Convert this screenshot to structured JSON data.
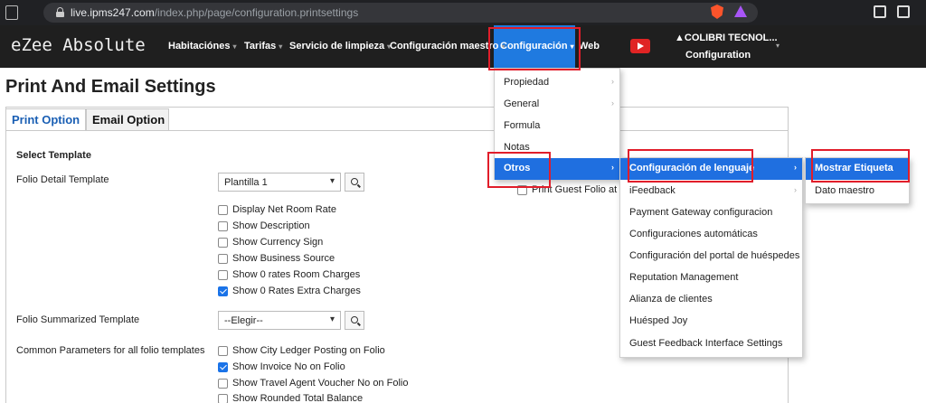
{
  "browser": {
    "url_host": "live.ipms247.com",
    "url_path": "/index.php/page/configuration.printsettings"
  },
  "app": {
    "logo": "eZee Absolute",
    "nav": [
      {
        "label": "Habitaciónes",
        "caret": "▾"
      },
      {
        "label": "Tarifas",
        "caret": "▾"
      },
      {
        "label": "Servicio de limpieza",
        "caret": "▾"
      },
      {
        "label": "Configuración maestro",
        "caret": "▾"
      },
      {
        "label": "Configuración",
        "caret": "▾"
      },
      {
        "label": "Web",
        "caret": ""
      }
    ],
    "user_name": "COLIBRI TECNOL...",
    "user_sub": "Configuration"
  },
  "page": {
    "title": "Print And Email Settings",
    "tabs": [
      "Print Option",
      "Email Option"
    ],
    "select_template": "Select Template",
    "folio_detail_label": "Folio Detail Template",
    "folio_detail_value": "Plantilla 1",
    "detail_checks": [
      {
        "label": "Display Net Room Rate",
        "checked": false
      },
      {
        "label": "Show Description",
        "checked": false
      },
      {
        "label": "Show Currency Sign",
        "checked": false
      },
      {
        "label": "Show Business Source",
        "checked": false
      },
      {
        "label": "Show 0 rates Room Charges",
        "checked": false
      },
      {
        "label": "Show 0 Rates Extra Charges",
        "checked": true
      }
    ],
    "folio_summarized_label": "Folio Summarized Template",
    "folio_summarized_value": "--Elegir--",
    "common_label": "Common Parameters for all folio templates",
    "common_checks": [
      {
        "label": "Show City Ledger Posting on Folio",
        "checked": false
      },
      {
        "label": "Show Invoice No on Folio",
        "checked": true
      },
      {
        "label": "Show Travel Agent Voucher No on Folio",
        "checked": false
      },
      {
        "label": "Show Rounded Total Balance",
        "checked": false
      }
    ],
    "hidden_partial": "Print Guest Folio at C"
  },
  "menu1": [
    "Propiedad",
    "General",
    "Formula",
    "Notas",
    "Otros"
  ],
  "menu2": [
    "Configuración de lenguaje",
    "iFeedback",
    "Payment Gateway configuracion",
    "Configuraciones automáticas",
    "Configuración del portal de huéspedes",
    "Reputation Management",
    "Alianza de clientes",
    "Huésped Joy",
    "Guest Feedback Interface Settings"
  ],
  "menu3": [
    "Mostrar Etiqueta",
    "Dato maestro"
  ],
  "colors": {
    "accent": "#1f6fe0",
    "highlight_box": "#e11d2a",
    "nav_bg": "#1f1f1f"
  }
}
